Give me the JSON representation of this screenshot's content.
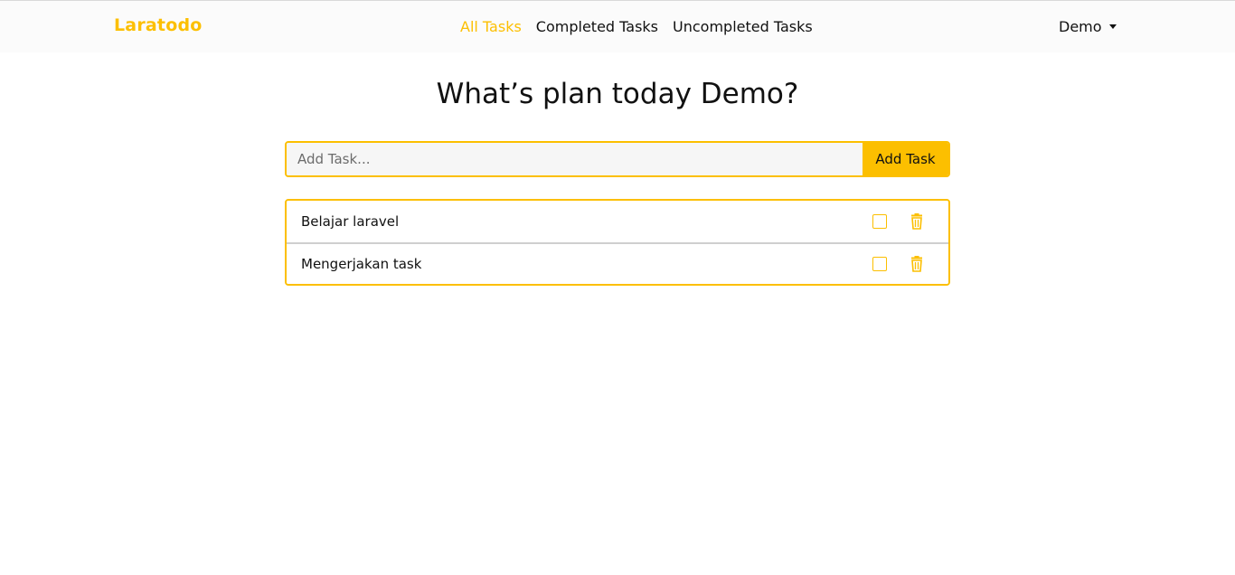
{
  "navbar": {
    "brand": "Laratodo",
    "links": [
      {
        "label": "All Tasks",
        "active": true
      },
      {
        "label": "Completed Tasks",
        "active": false
      },
      {
        "label": "Uncompleted Tasks",
        "active": false
      }
    ],
    "user": "Demo"
  },
  "main": {
    "title": "What’s plan today Demo?",
    "input_placeholder": "Add Task...",
    "input_value": "",
    "add_button_label": "Add Task",
    "tasks": [
      {
        "name": "Belajar laravel",
        "completed": false
      },
      {
        "name": "Mengerjakan task",
        "completed": false
      }
    ]
  },
  "colors": {
    "accent": "#fcbf00",
    "navbar_bg": "#fbfbfb",
    "input_bg": "#f6f6f6"
  },
  "icons": {
    "user_menu": "caret-down-icon",
    "task_delete": "trash-icon",
    "task_toggle": "checkbox"
  }
}
